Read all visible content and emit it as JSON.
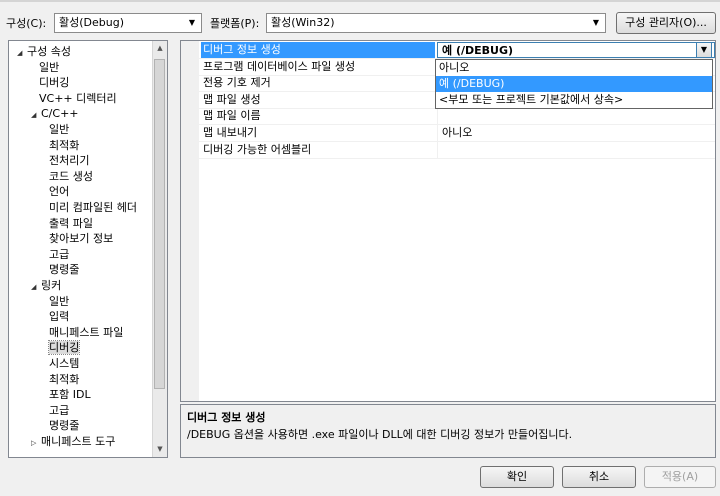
{
  "toolbar": {
    "config_label": "구성(C):",
    "config_value": "활성(Debug)",
    "platform_label": "플랫폼(P):",
    "platform_value": "활성(Win32)",
    "config_manager_button": "구성 관리자(O)..."
  },
  "tree": {
    "items": [
      {
        "label": "구성 속성",
        "expander": "◢"
      },
      {
        "label": "일반"
      },
      {
        "label": "디버깅"
      },
      {
        "label": "VC++ 디렉터리"
      },
      {
        "label": "C/C++",
        "expander": "◢"
      },
      {
        "label": "일반"
      },
      {
        "label": "최적화"
      },
      {
        "label": "전처리기"
      },
      {
        "label": "코드 생성"
      },
      {
        "label": "언어"
      },
      {
        "label": "미리 컴파일된 헤더"
      },
      {
        "label": "출력 파일"
      },
      {
        "label": "찾아보기 정보"
      },
      {
        "label": "고급"
      },
      {
        "label": "명령줄"
      },
      {
        "label": "링커",
        "expander": "◢"
      },
      {
        "label": "일반"
      },
      {
        "label": "입력"
      },
      {
        "label": "매니페스트 파일"
      },
      {
        "label": "디버깅",
        "selected": true
      },
      {
        "label": "시스템"
      },
      {
        "label": "최적화"
      },
      {
        "label": "포함 IDL"
      },
      {
        "label": "고급"
      },
      {
        "label": "명령줄"
      },
      {
        "label": "매니페스트 도구",
        "expander": "▷"
      }
    ]
  },
  "grid": {
    "rows": [
      {
        "name": "디버그 정보 생성",
        "value": "예 (/DEBUG)"
      },
      {
        "name": "프로그램 데이터베이스 파일 생성",
        "value": ""
      },
      {
        "name": "전용 기호 제거",
        "value": ""
      },
      {
        "name": "맵 파일 생성",
        "value": ""
      },
      {
        "name": "맵 파일 이름",
        "value": ""
      },
      {
        "name": "맵 내보내기",
        "value": "아니오"
      },
      {
        "name": "디버깅 가능한 어셈블리",
        "value": ""
      }
    ],
    "dropdown_options": [
      {
        "label": "아니오"
      },
      {
        "label": "예 (/DEBUG)",
        "selected": true
      },
      {
        "label": "<부모 또는 프로젝트 기본값에서 상속>"
      }
    ]
  },
  "description": {
    "title": "디버그 정보 생성",
    "text": "/DEBUG 옵션을 사용하면 .exe 파일이나 DLL에 대한 디버깅 정보가 만들어집니다."
  },
  "buttons": {
    "ok": "확인",
    "cancel": "취소",
    "apply": "적용(A)"
  },
  "colors": {
    "selection": "#3399ff",
    "background": "#f0f0f0"
  }
}
